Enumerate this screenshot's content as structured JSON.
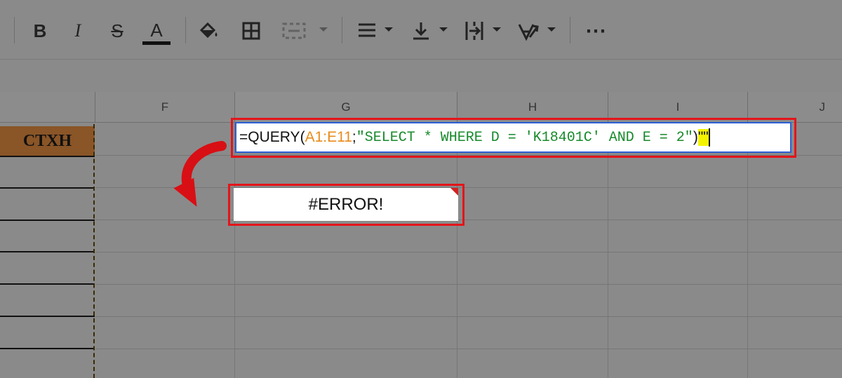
{
  "toolbar": {
    "items": [
      "bold-icon",
      "italic-icon",
      "strikethrough-icon",
      "text-color-icon",
      "fill-color-icon",
      "borders-icon",
      "merge-cells-icon",
      "horizontal-align-icon",
      "vertical-align-icon",
      "text-wrapping-icon",
      "text-rotation-icon",
      "more-icon"
    ],
    "bold": "B",
    "italic": "I",
    "strike": "S",
    "text_color": "A",
    "more": "⋯"
  },
  "columns": {
    "F": "F",
    "G": "G",
    "H": "H",
    "I": "I",
    "J": "J"
  },
  "cell_header": "CTXH",
  "formula": {
    "prefix": "=QUERY(",
    "range": "A1:E11",
    "sep": ";",
    "query": "\"SELECT * WHERE D = 'K18401C' AND E = 2\"",
    "close": ")",
    "extra": "\"\""
  },
  "error_cell": "#ERROR!",
  "colors": {
    "highlight_border": "#e3151a",
    "edit_border": "#2d5fd6",
    "range_color": "#e88b1a",
    "string_color": "#168a2a",
    "cursor_highlight": "#f3f300",
    "header_fill": "#8a5527"
  }
}
